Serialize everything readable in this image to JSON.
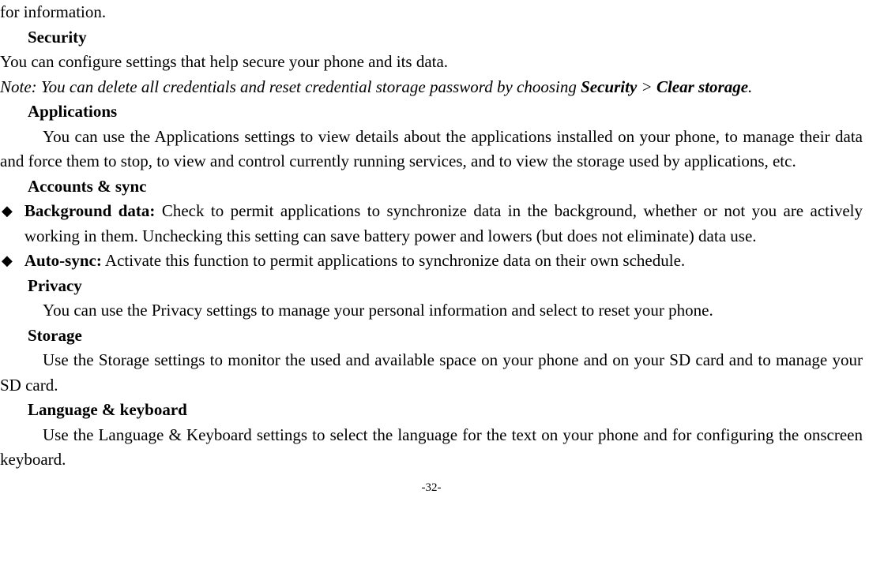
{
  "doc": {
    "line_top": "for information.",
    "heading_security": "Security",
    "p_security": "You can configure settings that help secure your phone and its data.",
    "note_prefix": "Note: You can delete all credentials and reset credential storage password by choosing ",
    "note_b1": "Security",
    "note_gt": " > ",
    "note_b2": "Clear storage",
    "note_period": ".",
    "heading_applications": "Applications",
    "p_applications": "You can use the Applications settings to view details about the applications installed on your phone, to manage their data and force them to stop, to view and control currently running services, and to view the storage used by applications, etc.",
    "heading_accounts": "Accounts & sync",
    "bullet1_label": "Background data:",
    "bullet1_text": " Check to permit applications to synchronize data in the background, whether or not you are actively working in them. Unchecking this setting can save battery power and lowers (but does not eliminate) data use.",
    "bullet2_label": "Auto-sync:",
    "bullet2_text": " Activate this function to permit applications to synchronize data on their own schedule.",
    "heading_privacy": "Privacy",
    "p_privacy": "You can use the Privacy settings to manage your personal information and select to reset your phone.",
    "heading_storage": "Storage",
    "p_storage": "Use the Storage settings to monitor the used and available space on your phone and on your SD card and to manage your SD card.",
    "heading_language": "Language & keyboard",
    "p_language": "Use the Language & Keyboard settings to select the language for the text on your phone and for configuring the onscreen keyboard.",
    "page_num": "-32-"
  }
}
